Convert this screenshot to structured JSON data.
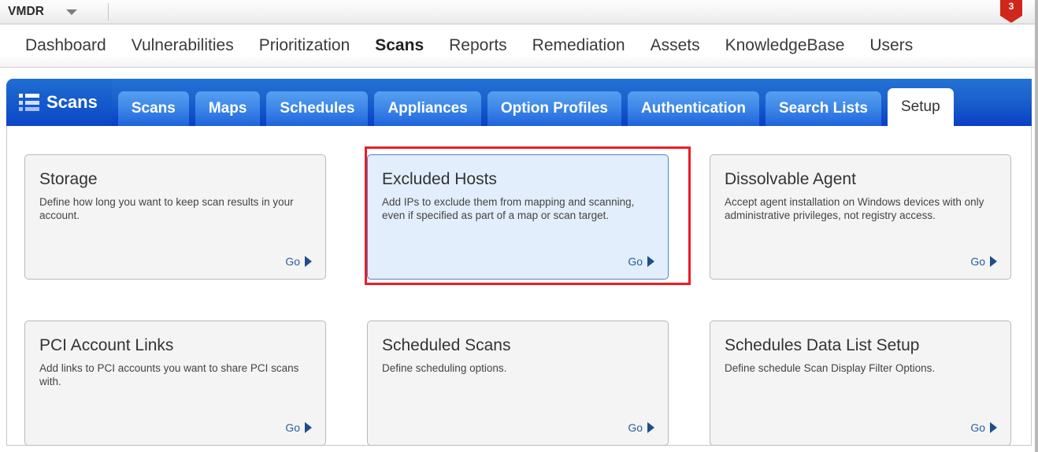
{
  "module_bar": {
    "module_name": "VMDR",
    "caret_icon": "chevron-down-icon",
    "notification_count": "3"
  },
  "main_nav": {
    "items": [
      {
        "label": "Dashboard",
        "active": false
      },
      {
        "label": "Vulnerabilities",
        "active": false
      },
      {
        "label": "Prioritization",
        "active": false
      },
      {
        "label": "Scans",
        "active": true
      },
      {
        "label": "Reports",
        "active": false
      },
      {
        "label": "Remediation",
        "active": false
      },
      {
        "label": "Assets",
        "active": false
      },
      {
        "label": "KnowledgeBase",
        "active": false
      },
      {
        "label": "Users",
        "active": false
      }
    ]
  },
  "tab_strip": {
    "brand_label": "Scans",
    "brand_icon": "list-icon",
    "tabs": [
      {
        "label": "Scans",
        "active": false
      },
      {
        "label": "Maps",
        "active": false
      },
      {
        "label": "Schedules",
        "active": false
      },
      {
        "label": "Appliances",
        "active": false
      },
      {
        "label": "Option Profiles",
        "active": false
      },
      {
        "label": "Authentication",
        "active": false
      },
      {
        "label": "Search Lists",
        "active": false
      },
      {
        "label": "Setup",
        "active": true
      }
    ]
  },
  "setup": {
    "go_label": "Go",
    "cards": [
      {
        "title": "Storage",
        "desc": "Define how long you want to keep scan results in your account.",
        "selected": false
      },
      {
        "title": "Excluded Hosts",
        "desc": "Add IPs to exclude them from mapping and scanning, even if specified as part of a map or scan target.",
        "selected": true
      },
      {
        "title": "Dissolvable Agent",
        "desc": "Accept agent installation on Windows devices with only administrative privileges, not registry access.",
        "selected": false
      },
      {
        "title": "PCI Account Links",
        "desc": "Add links to PCI accounts you want to share PCI scans with.",
        "selected": false
      },
      {
        "title": "Scheduled Scans",
        "desc": "Define scheduling options.",
        "selected": false
      },
      {
        "title": "Schedules Data List Setup",
        "desc": "Define schedule Scan Display Filter Options.",
        "selected": false
      }
    ]
  },
  "colors": {
    "accent_blue": "#1f63db",
    "highlight_red": "#ee1c25",
    "badge_red": "#d0271d",
    "selected_card_bg": "#e2eefb",
    "link_blue": "#2a5d9e"
  }
}
